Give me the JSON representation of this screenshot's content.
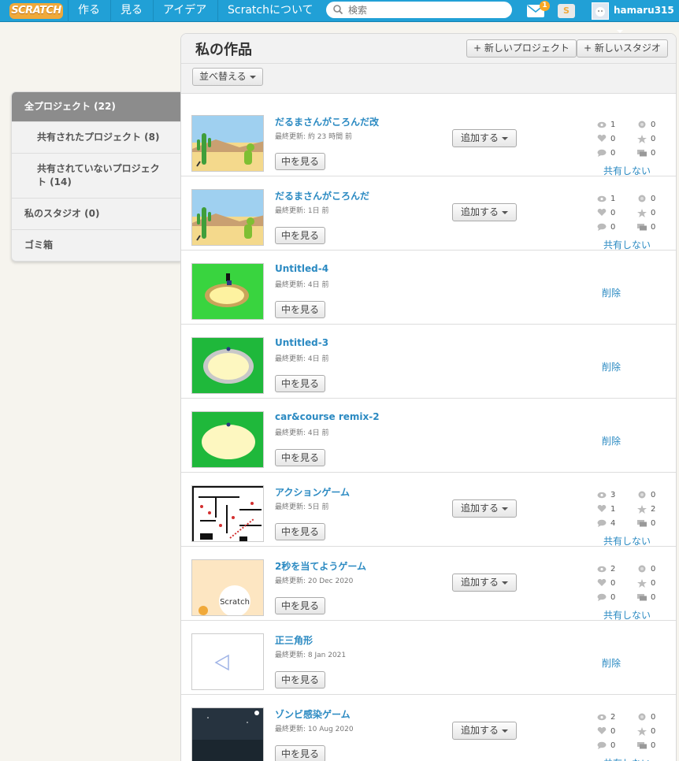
{
  "nav": {
    "logo": "SCRATCH",
    "links": [
      "作る",
      "見る",
      "アイデア",
      "Scratchについて"
    ],
    "search_placeholder": "検索",
    "mail_count": "1",
    "username": "hamaru315"
  },
  "sidebar": {
    "items": [
      {
        "label": "全プロジェクト (22)"
      },
      {
        "label": "共有されたプロジェクト (8)"
      },
      {
        "label": "共有されていないプロジェクト (14)"
      },
      {
        "label": "私のスタジオ (0)"
      },
      {
        "label": "ゴミ箱"
      }
    ]
  },
  "main": {
    "title": "私の作品",
    "new_project": "+ 新しいプロジェクト",
    "new_studio": "+ 新しいスタジオ",
    "sort": "並べ替える"
  },
  "labels": {
    "view": "中を見る",
    "add": "追加する",
    "unshare": "共有しない",
    "delete": "削除"
  },
  "projects": [
    {
      "title": "だるまさんがころんだ改",
      "updated": "最終更新: 約 23 時間 前",
      "shared": true,
      "views": "1",
      "loves": "0",
      "comments": "0",
      "remixes": "0",
      "favorites": "0",
      "studios": "0",
      "thumb": "desert"
    },
    {
      "title": "だるまさんがころんだ",
      "updated": "最終更新: 1日 前",
      "shared": true,
      "views": "1",
      "loves": "0",
      "comments": "0",
      "remixes": "0",
      "favorites": "0",
      "studios": "0",
      "thumb": "desert"
    },
    {
      "title": "Untitled-4",
      "updated": "最終更新: 4日 前",
      "shared": false,
      "thumb": "track1"
    },
    {
      "title": "Untitled-3",
      "updated": "最終更新: 4日 前",
      "shared": false,
      "thumb": "track2"
    },
    {
      "title": "car&course remix-2",
      "updated": "最終更新: 4日 前",
      "shared": false,
      "thumb": "track3"
    },
    {
      "title": "アクションゲーム",
      "updated": "最終更新: 5日 前",
      "shared": true,
      "views": "3",
      "loves": "1",
      "comments": "4",
      "remixes": "0",
      "favorites": "2",
      "studios": "0",
      "thumb": "maze"
    },
    {
      "title": "2秒を当てようゲーム",
      "updated": "最終更新: 20 Dec 2020",
      "shared": true,
      "views": "2",
      "loves": "0",
      "comments": "0",
      "remixes": "0",
      "favorites": "0",
      "studios": "0",
      "thumb": "scratch",
      "thumb_text": "Scratch"
    },
    {
      "title": "正三角形",
      "updated": "最終更新: 8 Jan 2021",
      "shared": false,
      "thumb": "triangle"
    },
    {
      "title": "ゾンビ感染ゲーム",
      "updated": "最終更新: 10 Aug 2020",
      "shared": true,
      "views": "2",
      "loves": "0",
      "comments": "0",
      "remixes": "0",
      "favorites": "0",
      "studios": "0",
      "thumb": "night"
    }
  ]
}
